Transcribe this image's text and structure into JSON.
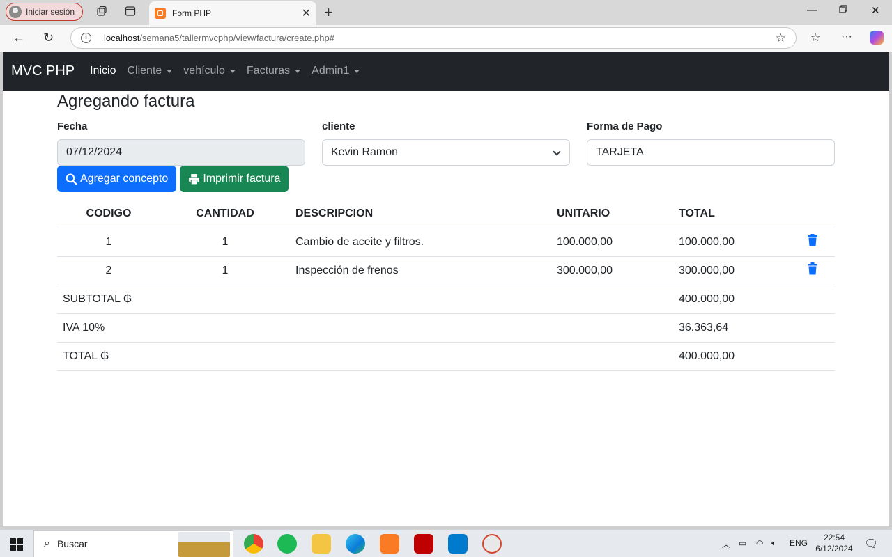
{
  "browser": {
    "profile_label": "Iniciar sesión",
    "tab_title": "Form PHP",
    "url_host": "localhost",
    "url_path": "/semana5/tallermvcphp/view/factura/create.php#"
  },
  "navbar": {
    "brand": "MVC PHP",
    "items": [
      {
        "label": "Inicio",
        "active": true,
        "dropdown": false
      },
      {
        "label": "Cliente",
        "active": false,
        "dropdown": true
      },
      {
        "label": "vehículo",
        "active": false,
        "dropdown": true
      },
      {
        "label": "Facturas",
        "active": false,
        "dropdown": true
      },
      {
        "label": "Admin1",
        "active": false,
        "dropdown": true
      }
    ]
  },
  "page": {
    "title": "Agregando factura",
    "fecha_label": "Fecha",
    "fecha_value": "07/12/2024",
    "cliente_label": "cliente",
    "cliente_value": "Kevin Ramon",
    "pago_label": "Forma de Pago",
    "pago_value": "TARJETA",
    "btn_agregar": "Agregar concepto",
    "btn_imprimir": "Imprimir factura"
  },
  "table": {
    "headers": [
      "CODIGO",
      "CANTIDAD",
      "DESCRIPCION",
      "UNITARIO",
      "TOTAL"
    ],
    "rows": [
      {
        "codigo": "1",
        "cantidad": "1",
        "descripcion": "Cambio de aceite y filtros.",
        "unitario": "100.000,00",
        "total": "100.000,00"
      },
      {
        "codigo": "2",
        "cantidad": "1",
        "descripcion": "Inspección de frenos",
        "unitario": "300.000,00",
        "total": "300.000,00"
      }
    ],
    "subtotal_label": "SUBTOTAL ₲",
    "subtotal_value": "400.000,00",
    "iva_label": "IVA 10%",
    "iva_value": "36.363,64",
    "total_label": "TOTAL ₲",
    "total_value": "400.000,00"
  },
  "taskbar": {
    "search_label": "Buscar",
    "lang": "ENG",
    "time": "22:54",
    "date": "6/12/2024"
  },
  "colors": {
    "primary": "#0d6efd",
    "success": "#198754",
    "navbar_bg": "#212529"
  }
}
